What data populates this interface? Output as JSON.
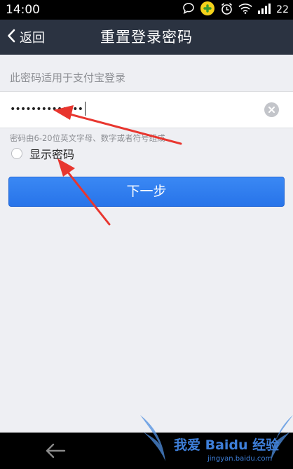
{
  "status_bar": {
    "time": "14:00",
    "battery": "22",
    "icons": [
      "chat-icon",
      "app-badge-icon",
      "alarm-icon",
      "wifi-icon",
      "signal-icon",
      "battery-icon"
    ]
  },
  "nav": {
    "back_label": "返回",
    "title": "重置登录密码"
  },
  "form": {
    "hint": "此密码适用于支付宝登录",
    "password_value": "••••••••••••••",
    "rule_hint": "密码由6-20位英文字母、数字或者符号组成",
    "show_password_label": "显示密码",
    "show_password_checked": false,
    "next_button": "下一步"
  },
  "annotations": {
    "arrow_color": "#e8362f",
    "arrow_count": 2
  },
  "watermark": {
    "text": "我爱 Baidu 经验",
    "url": "jingyan.baidu.com"
  },
  "colors": {
    "status_bar": "#000000",
    "nav_bar": "#2b3341",
    "background": "#eeeff3",
    "primary_button": "#2f7ff0"
  }
}
